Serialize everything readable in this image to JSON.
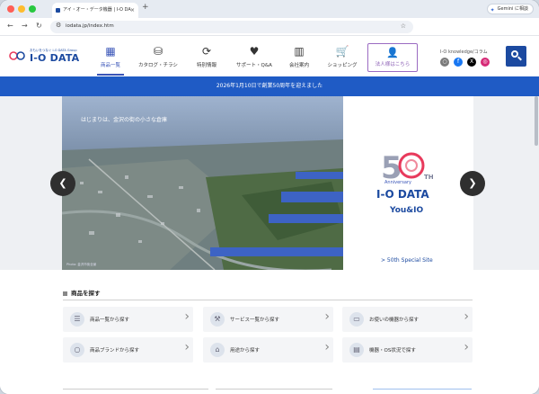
{
  "browser": {
    "tab_title": "アイ・オー・データ機器 | I-O DA",
    "tab_close": "×",
    "new_tab": "+",
    "url": "iodata.jp/index.htm",
    "gemini_label": "Gemini に相談",
    "icons": [
      "reload-icon",
      "back-icon",
      "forward-icon",
      "star-icon",
      "tune-icon"
    ]
  },
  "site": {
    "logo_sub": "おもいをつなぐ I-O DATA Group",
    "logo_text": "I-O DATA",
    "nav": [
      {
        "label": "商品一覧",
        "icon": "grid-icon",
        "glyph": "▦"
      },
      {
        "label": "カタログ・チラシ",
        "icon": "catalog-icon",
        "glyph": "⛁"
      },
      {
        "label": "特別情報",
        "icon": "refresh-icon",
        "glyph": "⟳"
      },
      {
        "label": "サポート・Q&A",
        "icon": "heart-icon",
        "glyph": "♥"
      },
      {
        "label": "会社案内",
        "icon": "building-icon",
        "glyph": "▥"
      },
      {
        "label": "ショッピング",
        "icon": "cart-icon",
        "glyph": "🛒"
      }
    ],
    "corp_button": "法人様はこちら",
    "knowledge": "I-O knowledge/コラム",
    "sns": [
      {
        "name": "knowledge-icon",
        "glyph": "○",
        "color": "#7a7a7a"
      },
      {
        "name": "facebook-icon",
        "glyph": "f",
        "color": "#1877f2"
      },
      {
        "name": "x-icon",
        "glyph": "X",
        "color": "#000000"
      },
      {
        "name": "instagram-icon",
        "glyph": "◎",
        "color": "#d62976"
      }
    ]
  },
  "announcement": "2026年1月10日で創業50周年を迎えました",
  "hero": {
    "caption": "はじまりは、金沢の街の小さな倉庫",
    "credit": "Photo: 金沢市街全景",
    "anniversary_word": "Anniversary",
    "logo": "I-O DATA",
    "you_io": "You&IO",
    "link": "> 50th Special Site",
    "prev": "❮",
    "next": "❯"
  },
  "products": {
    "title": "商品を探す",
    "cards": [
      {
        "label": "商品一覧から探す",
        "glyph": "☰"
      },
      {
        "label": "サービス一覧から探す",
        "glyph": "⚒"
      },
      {
        "label": "お使いの機器から探す",
        "glyph": "▭"
      },
      {
        "label": "商品ブランドから探す",
        "glyph": "○"
      },
      {
        "label": "用途から探す",
        "glyph": "⌂"
      },
      {
        "label": "機器・OS状況で探す",
        "glyph": "▤"
      }
    ],
    "chevron": "›"
  },
  "colors": {
    "brand": "#1c4aa0",
    "announce": "#1f5bc5",
    "corp": "#8a5db4"
  }
}
